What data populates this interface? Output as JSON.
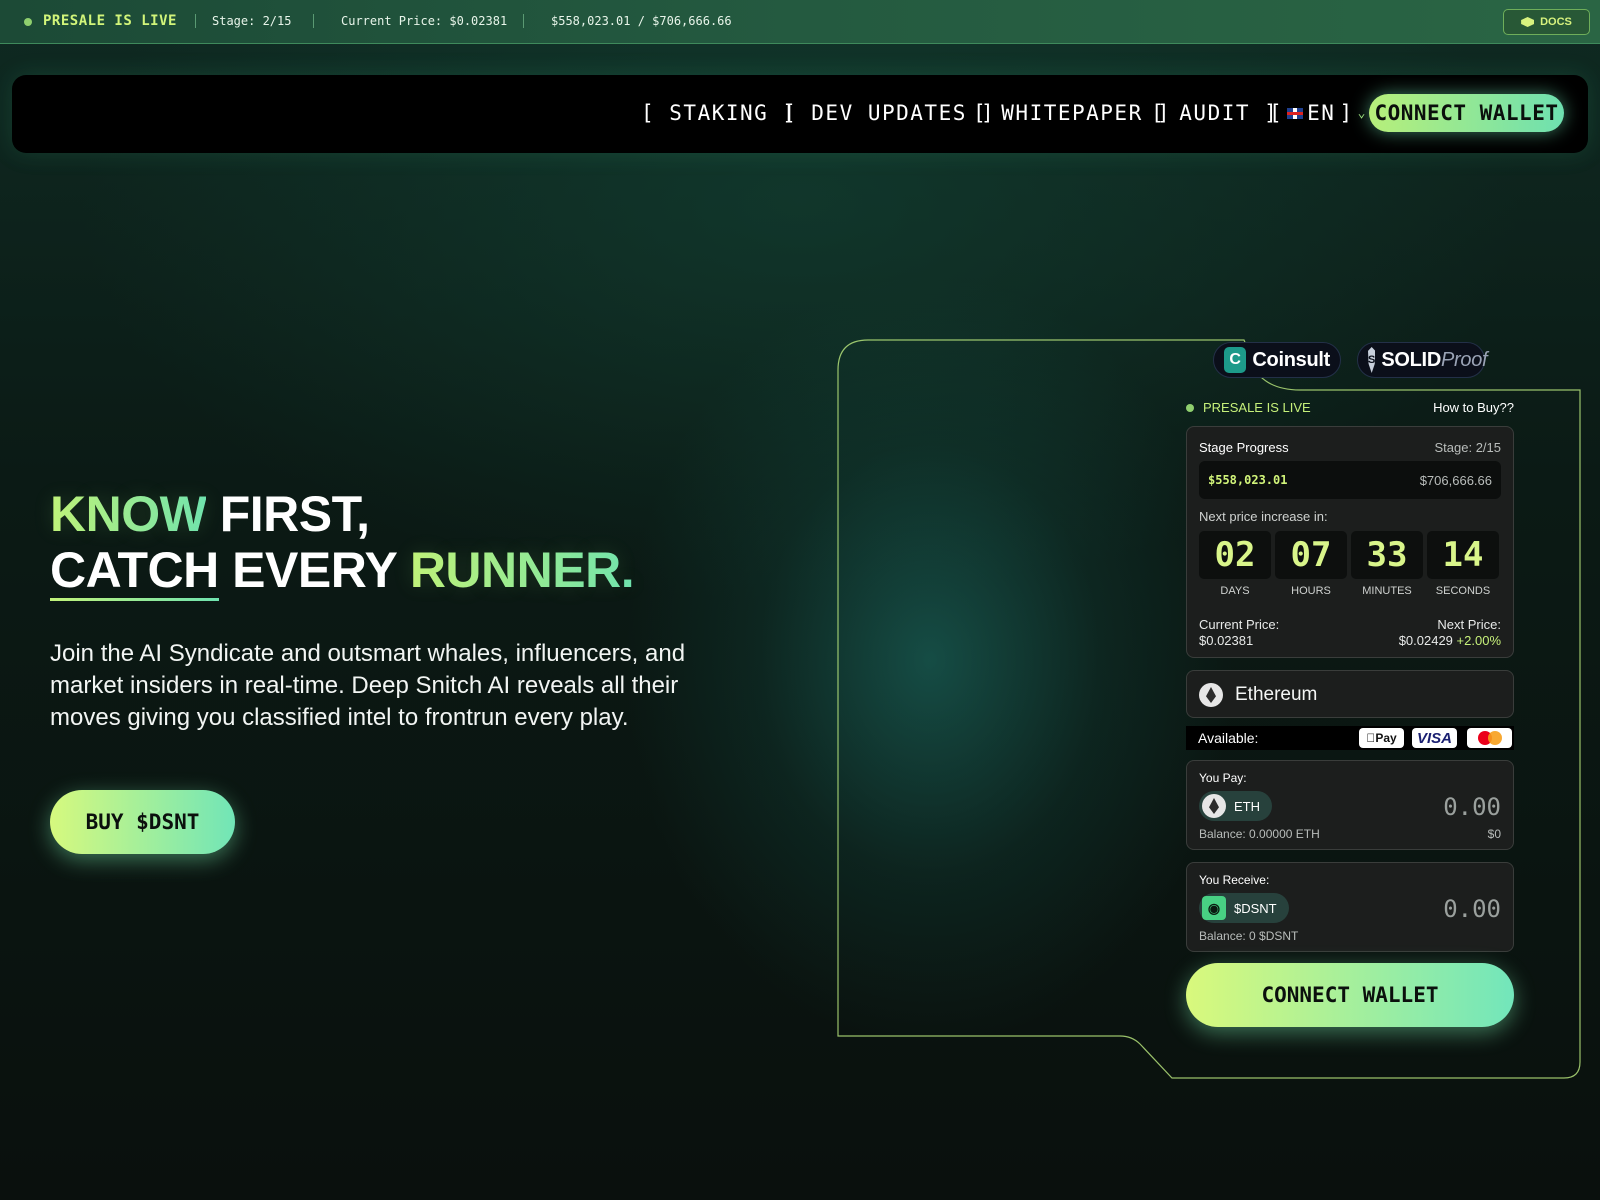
{
  "ticker": {
    "live_label": "PRESALE IS LIVE",
    "stage": "Stage: 2/15",
    "price": "Current Price: $0.02381",
    "raised": "$558,023.01 / $706,666.66",
    "docs_label": "DOCS"
  },
  "nav": {
    "items": [
      "[ STAKING ]",
      "[ DEV UPDATES ]",
      "[ WHITEPAPER ]",
      "[ AUDIT ]"
    ],
    "lang_open": "[",
    "lang": "EN",
    "lang_close": "]",
    "connect_label": "CONNECT WALLET"
  },
  "hero": {
    "line1_a": "KNOW",
    "line1_b": "FIRST,",
    "line2_a": "CATCH",
    "line2_b": "EVERY",
    "line2_c": "RUNNER.",
    "description": "Join the AI Syndicate and outsmart whales, influencers, and market insiders in real-time. Deep Snitch AI reveals all their moves giving you classified intel to frontrun every play.",
    "buy_label": "BUY $DSNT"
  },
  "badges": {
    "coinsult": "Coinsult",
    "solid": "SOLID",
    "proof": "Proof"
  },
  "widget": {
    "presale_live": "PRESALE IS LIVE",
    "how_to_buy": "How to Buy??",
    "stage_progress": "Stage Progress",
    "stage": "Stage: 2/15",
    "raised": "$558,023.01",
    "goal": "$706,666.66",
    "next_increase": "Next price increase in:",
    "countdown": [
      {
        "value": "02",
        "label": "DAYS"
      },
      {
        "value": "07",
        "label": "HOURS"
      },
      {
        "value": "33",
        "label": "MINUTES"
      },
      {
        "value": "14",
        "label": "SECONDS"
      }
    ],
    "current_price_label": "Current Price:",
    "current_price": "$0.02381",
    "next_price_label": "Next Price:",
    "next_price": "$0.02429",
    "next_price_change": "+2.00%",
    "network": "Ethereum",
    "available": "Available:",
    "payment_methods": [
      "Pay",
      "VISA"
    ],
    "you_pay": "You Pay:",
    "pay_token": "ETH",
    "pay_amount": "0.00",
    "pay_balance": "Balance: 0.00000 ETH",
    "pay_usd": "$0",
    "you_receive": "You Receive:",
    "receive_token": "$DSNT",
    "receive_amount": "0.00",
    "receive_balance": "Balance: 0 $DSNT",
    "connect_label": "CONNECT WALLET"
  },
  "colors": {
    "accent_lime": "#c6f07a",
    "accent_mint": "#6fe3b0",
    "ticker_bg": "#245a40"
  }
}
